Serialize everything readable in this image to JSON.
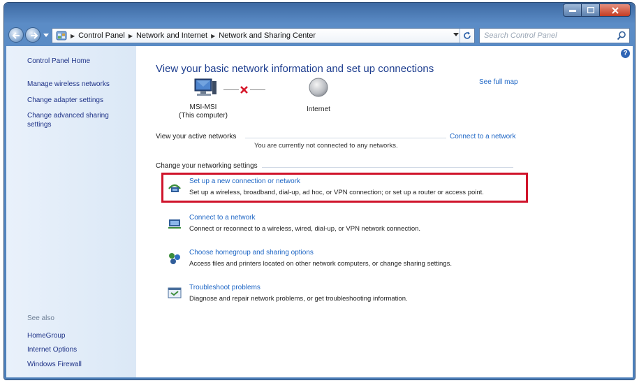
{
  "window": {
    "caption_buttons": {
      "minimize_icon": "minimize-icon",
      "maximize_icon": "maximize-icon",
      "close_icon": "close-icon"
    }
  },
  "address_bar": {
    "crumbs": [
      "Control Panel",
      "Network and Internet",
      "Network and Sharing Center"
    ]
  },
  "search": {
    "placeholder": "Search Control Panel"
  },
  "sidebar": {
    "home": "Control Panel Home",
    "links": [
      "Manage wireless networks",
      "Change adapter settings",
      "Change advanced sharing settings"
    ],
    "see_also_header": "See also",
    "see_also": [
      "HomeGroup",
      "Internet Options",
      "Windows Firewall"
    ]
  },
  "main": {
    "title": "View your basic network information and set up connections",
    "see_full_map": "See full map",
    "computer_name": "MSI-MSI",
    "computer_sub": "(This computer)",
    "internet_label": "Internet",
    "active_networks_label": "View your active networks",
    "connect_to_network": "Connect to a network",
    "not_connected_text": "You are currently not connected to any networks.",
    "change_settings_label": "Change your networking settings",
    "tasks": [
      {
        "link": "Set up a new connection or network",
        "desc": "Set up a wireless, broadband, dial-up, ad hoc, or VPN connection; or set up a router or access point.",
        "icon": "network-setup-icon"
      },
      {
        "link": "Connect to a network",
        "desc": "Connect or reconnect to a wireless, wired, dial-up, or VPN network connection.",
        "icon": "connect-network-icon"
      },
      {
        "link": "Choose homegroup and sharing options",
        "desc": "Access files and printers located on other network computers, or change sharing settings.",
        "icon": "homegroup-icon"
      },
      {
        "link": "Troubleshoot problems",
        "desc": "Diagnose and repair network problems, or get troubleshooting information.",
        "icon": "troubleshoot-icon"
      }
    ]
  },
  "colors": {
    "link": "#1e66c5",
    "title": "#1e3e8f",
    "highlight": "#d0142b",
    "sidebar_bg": "#dbe8f6"
  }
}
